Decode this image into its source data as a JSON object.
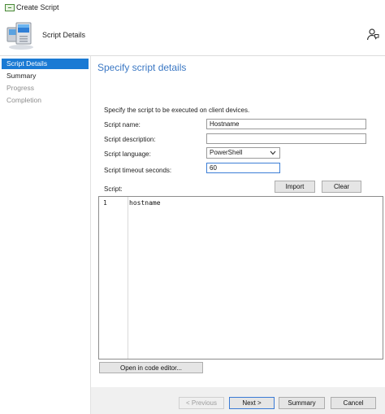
{
  "window": {
    "title": "Create Script"
  },
  "header": {
    "title": "Script Details"
  },
  "sidebar": {
    "items": [
      {
        "label": "Script Details",
        "state": "active"
      },
      {
        "label": "Summary",
        "state": "normal"
      },
      {
        "label": "Progress",
        "state": "disabled"
      },
      {
        "label": "Completion",
        "state": "disabled"
      }
    ]
  },
  "page": {
    "title": "Specify script details",
    "intro": "Specify the script to be executed on client devices."
  },
  "form": {
    "script_name": {
      "label": "Script name:",
      "value": "Hostname"
    },
    "script_description": {
      "label": "Script description:",
      "value": ""
    },
    "script_language": {
      "label": "Script language:",
      "value": "PowerShell"
    },
    "script_timeout": {
      "label": "Script timeout seconds:",
      "value": "60"
    },
    "script_label": "Script:"
  },
  "buttons": {
    "import": "Import",
    "clear": "Clear",
    "open_editor": "Open in code editor...",
    "previous": "< Previous",
    "next": "Next >",
    "summary": "Summary",
    "cancel": "Cancel"
  },
  "editor": {
    "lines": [
      {
        "number": "1",
        "text": "hostname"
      }
    ]
  },
  "colors": {
    "accent": "#1a7ad4",
    "title_blue": "#3b78c4",
    "footer_bg": "#f0f0f0"
  },
  "icons": {
    "app": "window-icon",
    "header": "computers-icon",
    "user": "user-feedback-icon",
    "dropdown": "chevron-down-icon"
  }
}
